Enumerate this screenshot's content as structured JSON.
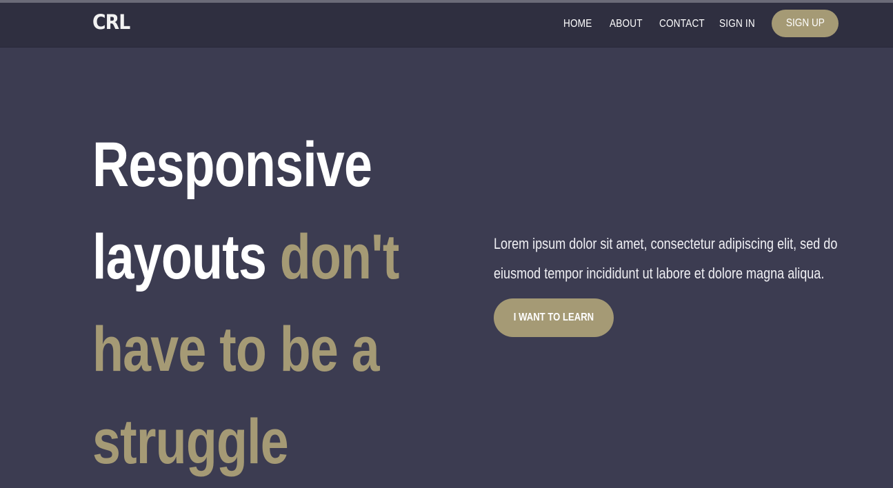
{
  "brand": {
    "logo_text": "CRL",
    "accent_color": "#a59a75",
    "nav_background": "#2f2f40",
    "page_background": "#3c3c51"
  },
  "nav": {
    "links": [
      "HOME",
      "ABOUT",
      "CONTACT",
      "SIGN IN"
    ],
    "signup_label": "SIGN UP"
  },
  "hero": {
    "headline_line1": "Responsive",
    "headline_line2_white": "layouts",
    "headline_line2_accent": "don't",
    "headline_line3": "have to be a",
    "headline_line4": "struggle",
    "description_line1": "Lorem ipsum dolor sit amet, consectetur adipiscing elit, sed do",
    "description_line2": "eiusmod tempor incididunt ut labore et dolore magna aliqua.",
    "cta_label": "I WANT TO LEARN"
  }
}
